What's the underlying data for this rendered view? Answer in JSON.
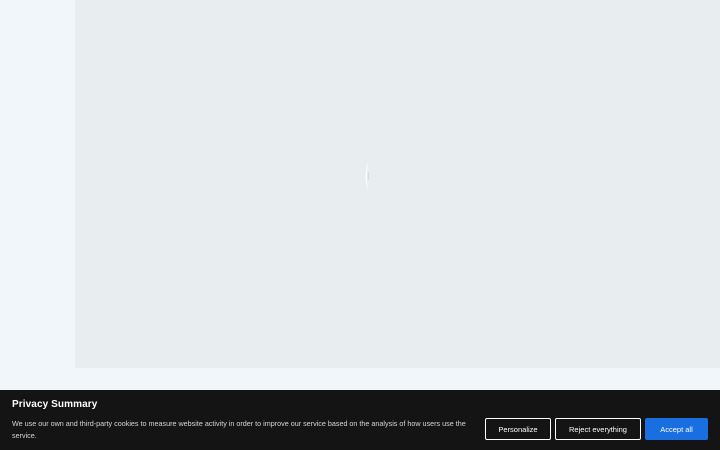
{
  "cookie_banner": {
    "title": "Privacy Summary",
    "text": "We use our own and third-party cookies to measure website activity in order to improve our service based on the analysis of how users use the service.",
    "buttons": {
      "personalize": "Personalize",
      "reject": "Reject everything",
      "accept": "Accept all"
    }
  },
  "colors": {
    "page_background": "#f0f6f9",
    "content_background": "#e8edf0",
    "banner_background": "#141414",
    "accept_button": "#1a6fe0"
  },
  "icons": {
    "loading": "loading-spinner-icon"
  }
}
